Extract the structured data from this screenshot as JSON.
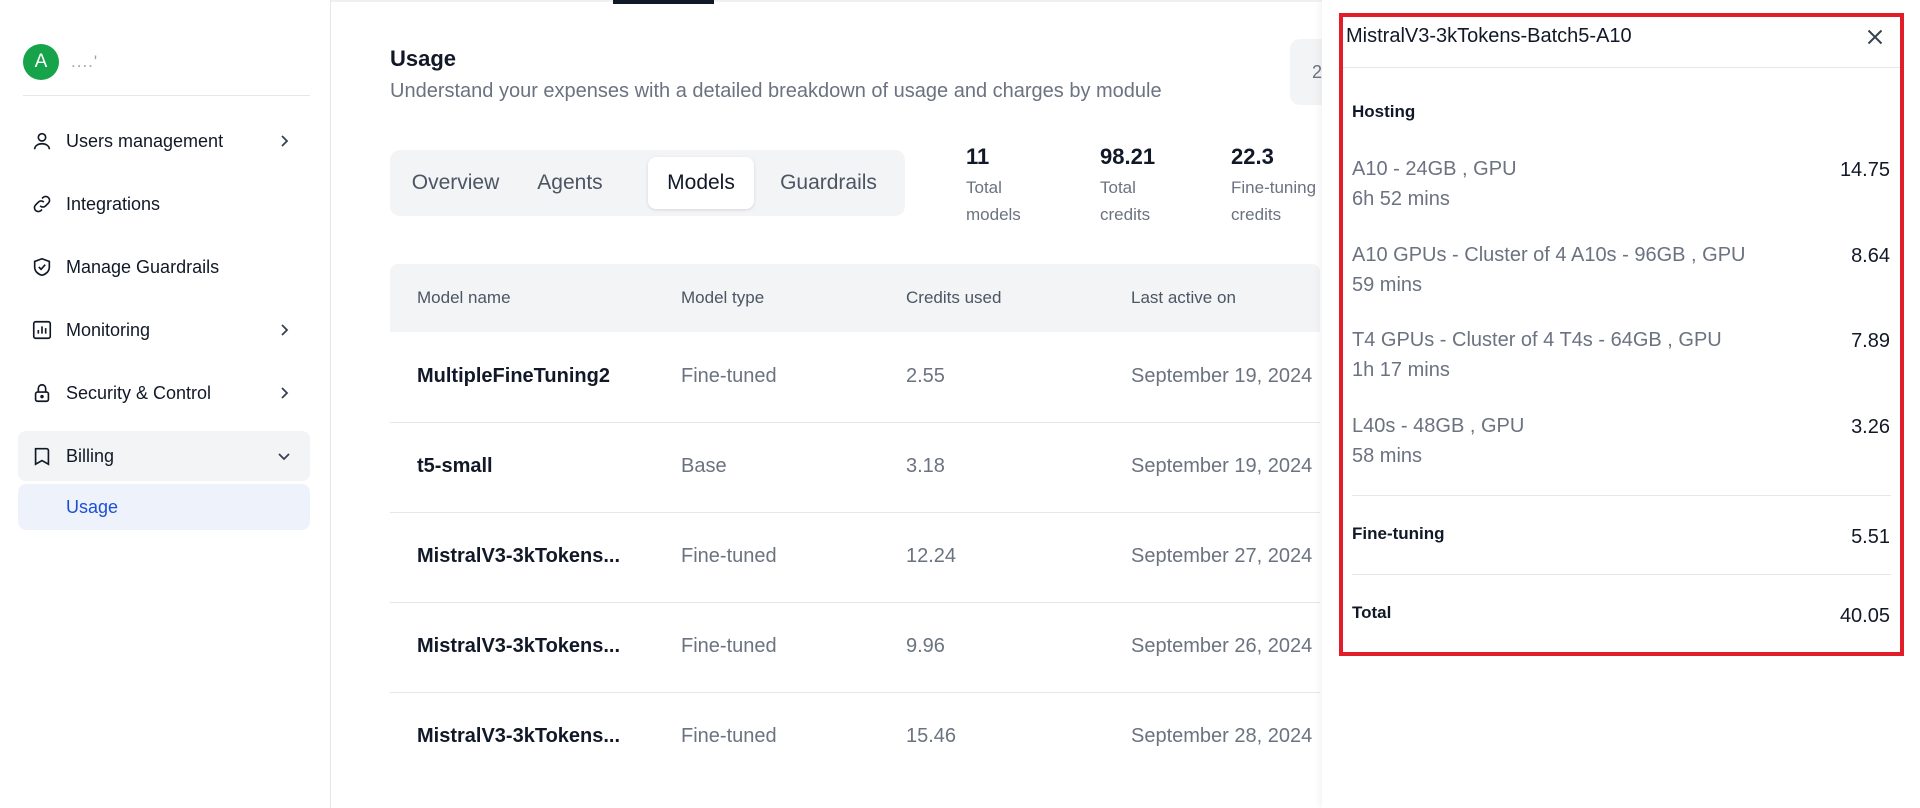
{
  "sidebar": {
    "avatar_letter": "A",
    "user_name": "....'",
    "items": [
      {
        "label": "Users management",
        "icon": "user-icon",
        "has_chevron": true
      },
      {
        "label": "Integrations",
        "icon": "link-icon",
        "has_chevron": false
      },
      {
        "label": "Manage Guardrails",
        "icon": "shield-check-icon",
        "has_chevron": false
      },
      {
        "label": "Monitoring",
        "icon": "bar-chart-icon",
        "has_chevron": true
      },
      {
        "label": "Security & Control",
        "icon": "lock-icon",
        "has_chevron": true
      },
      {
        "label": "Billing",
        "icon": "book-icon",
        "has_chevron": true,
        "expanded": true
      }
    ],
    "sub_item": "Usage"
  },
  "main": {
    "title": "Usage",
    "subtitle": "Understand your expenses with a detailed breakdown of usage and charges by module",
    "date_button_partial": "2",
    "tabs": [
      "Overview",
      "Agents",
      "Models",
      "Guardrails"
    ],
    "active_tab": "Models",
    "stats": [
      {
        "value": "11",
        "label": "Total models"
      },
      {
        "value": "98.21",
        "label": "Total credits"
      },
      {
        "value": "22.3",
        "label": "Fine-tuning credits"
      }
    ],
    "table": {
      "headers": [
        "Model name",
        "Model type",
        "Credits used",
        "Last active on"
      ],
      "rows": [
        [
          "MultipleFineTuning2",
          "Fine-tuned",
          "2.55",
          "September 19, 2024"
        ],
        [
          "t5-small",
          "Base",
          "3.18",
          "September 19, 2024"
        ],
        [
          "MistralV3-3kTokens...",
          "Fine-tuned",
          "12.24",
          "September 27, 2024"
        ],
        [
          "MistralV3-3kTokens...",
          "Fine-tuned",
          "9.96",
          "September 26, 2024"
        ],
        [
          "MistralV3-3kTokens...",
          "Fine-tuned",
          "15.46",
          "September 28, 2024"
        ]
      ]
    }
  },
  "drawer": {
    "title": "MistralV3-3kTokens-Batch5-A10",
    "hosting_label": "Hosting",
    "hosting_items": [
      {
        "name": "A10 - 24GB , GPU",
        "duration": "6h 52 mins",
        "value": "14.75"
      },
      {
        "name": "A10 GPUs - Cluster of 4 A10s - 96GB , GPU",
        "duration": "59 mins",
        "value": "8.64"
      },
      {
        "name": "T4 GPUs - Cluster of 4 T4s - 64GB , GPU",
        "duration": "1h 17 mins",
        "value": "7.89"
      },
      {
        "name": "L40s - 48GB , GPU",
        "duration": "58 mins",
        "value": "3.26"
      }
    ],
    "finetuning_label": "Fine-tuning",
    "finetuning_value": "5.51",
    "total_label": "Total",
    "total_value": "40.05"
  },
  "colors": {
    "accent": "#1d4ed8",
    "avatar": "#16a34a",
    "highlight_border": "#e11d2a"
  }
}
